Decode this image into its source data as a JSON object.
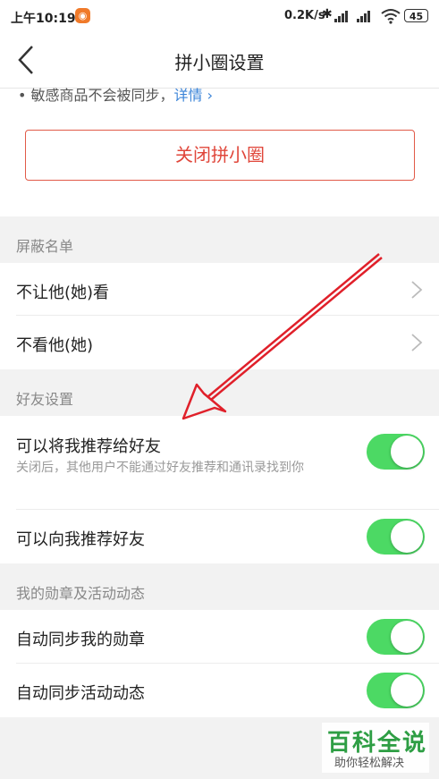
{
  "status": {
    "time": "上午10:19",
    "net_speed": "0.2K/s",
    "battery": "45",
    "bt_icon": "bluetooth-icon",
    "wifi_icon": "wifi-icon"
  },
  "header": {
    "title": "拼小圈设置",
    "back_icon": "back-chevron-icon"
  },
  "top": {
    "note_text": "• 敏感商品不会被同步，",
    "note_link": "详情 ›",
    "close_button": "关闭拼小圈"
  },
  "sections": {
    "block": {
      "title": "屏蔽名单",
      "items": [
        "不让他(她)看",
        "不看他(她)"
      ]
    },
    "friends": {
      "title": "好友设置",
      "recommend_me": "可以将我推荐给好友",
      "recommend_me_desc": "关闭后，其他用户不能通过好友推荐和通讯录找到你",
      "recommend_to_me": "可以向我推荐好友"
    },
    "badges": {
      "title": "我的勋章及活动动态",
      "sync_badges": "自动同步我的勋章",
      "sync_activity": "自动同步活动动态"
    }
  },
  "toggles": {
    "recommend_me": true,
    "recommend_to_me": true,
    "sync_badges": true,
    "sync_activity": true
  },
  "colors": {
    "toggle_on": "#4cd964",
    "close_button": "#e0463a",
    "link": "#3b84d8",
    "annotation_arrow": "#e0202a"
  },
  "watermark": {
    "main": "百科全说",
    "sub": "助你轻松解决"
  }
}
